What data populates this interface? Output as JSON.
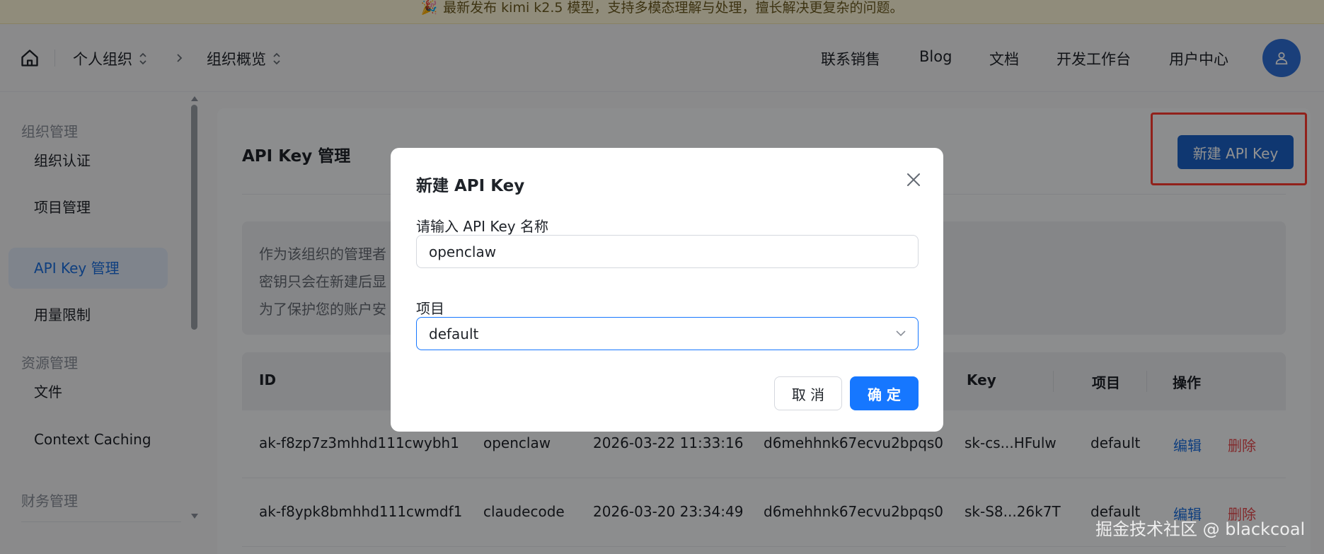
{
  "announcement": {
    "emoji": "🎉",
    "text": "最新发布 kimi k2.5 模型，支持多模态理解与处理，擅长解决更复杂的问题。"
  },
  "header": {
    "org": "个人组织",
    "page": "组织概览",
    "links": [
      "联系销售",
      "Blog",
      "文档",
      "开发工作台",
      "用户中心"
    ]
  },
  "sidebar": {
    "section_org": "组织管理",
    "org_items": [
      "组织认证",
      "项目管理",
      "API Key 管理",
      "用量限制"
    ],
    "section_res": "资源管理",
    "res_items": [
      "文件",
      "Context Caching"
    ],
    "section_fin": "财务管理"
  },
  "main": {
    "title": "API Key 管理",
    "new_button": "新建 API Key",
    "notice": [
      "作为该组织的管理者",
      "密钥只会在新建后显",
      "为了保护您的账户安"
    ],
    "columns": [
      "ID",
      "Key",
      "项目",
      "操作"
    ],
    "rows": [
      {
        "id": "ak-f8zp7z3mhhd111cwybh1",
        "name": "openclaw",
        "created": "2026-03-22 11:33:16",
        "project_id": "d6mehhnk67ecvu2bpqs0",
        "key": "sk-cs...HFulw",
        "project": "default",
        "edit": "编辑",
        "delete": "删除"
      },
      {
        "id": "ak-f8ypk8bmhhd111cwmdf1",
        "name": "claudecode",
        "created": "2026-03-20 23:34:49",
        "project_id": "d6mehhnk67ecvu2bpqs0",
        "key": "sk-S8...26k7T",
        "project": "default",
        "edit": "编辑",
        "delete": "删除"
      }
    ]
  },
  "modal": {
    "title": "新建 API Key",
    "name_label": "请输入 API Key 名称",
    "name_value": "openclaw",
    "project_label": "项目",
    "project_value": "default",
    "cancel": "取 消",
    "ok": "确 定"
  },
  "watermark": "掘金技术社区 @ blackcoal",
  "colors": {
    "primary": "#1677ff",
    "highlight": "#ff3b30",
    "delete": "#e5484d"
  }
}
